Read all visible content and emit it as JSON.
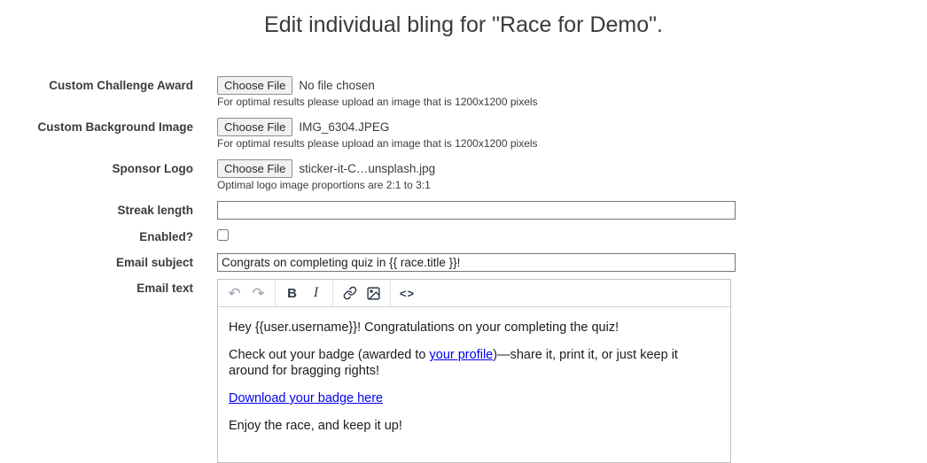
{
  "title": "Edit individual bling for \"Race for Demo\".",
  "fields": {
    "award": {
      "label": "Custom Challenge Award",
      "button": "Choose File",
      "file": "No file chosen",
      "helper": "For optimal results please upload an image that is 1200x1200 pixels"
    },
    "background": {
      "label": "Custom Background Image",
      "button": "Choose File",
      "file": "IMG_6304.JPEG",
      "helper": "For optimal results please upload an image that is 1200x1200 pixels"
    },
    "sponsor": {
      "label": "Sponsor Logo",
      "button": "Choose File",
      "file": "sticker-it-C…unsplash.jpg",
      "helper": "Optimal logo image proportions are 2:1 to 3:1"
    },
    "streak": {
      "label": "Streak length",
      "value": ""
    },
    "enabled": {
      "label": "Enabled?",
      "checked": false
    },
    "subject": {
      "label": "Email subject",
      "value": "Congrats on completing quiz in {{ race.title }}!"
    },
    "email_text": {
      "label": "Email text"
    }
  },
  "editor": {
    "toolbar": {
      "undo": "↶",
      "redo": "↷",
      "bold": "B",
      "italic": "I",
      "link": "link-icon",
      "image": "image-icon",
      "code": "<>"
    },
    "content": {
      "p1": "Hey {{user.username}}! Congratulations on your completing the quiz!",
      "p2_before": "Check out your badge (awarded to ",
      "p2_link": "your profile",
      "p2_after": ")—share it, print it, or just keep it around for bragging rights!",
      "p3_link": "Download your badge here",
      "p4": "Enjoy the race, and keep it up!"
    }
  },
  "colors": {
    "link": "#0000ee",
    "toolbar_icon": "#2f3b4c",
    "toolbar_icon_disabled": "#99a3ad"
  }
}
